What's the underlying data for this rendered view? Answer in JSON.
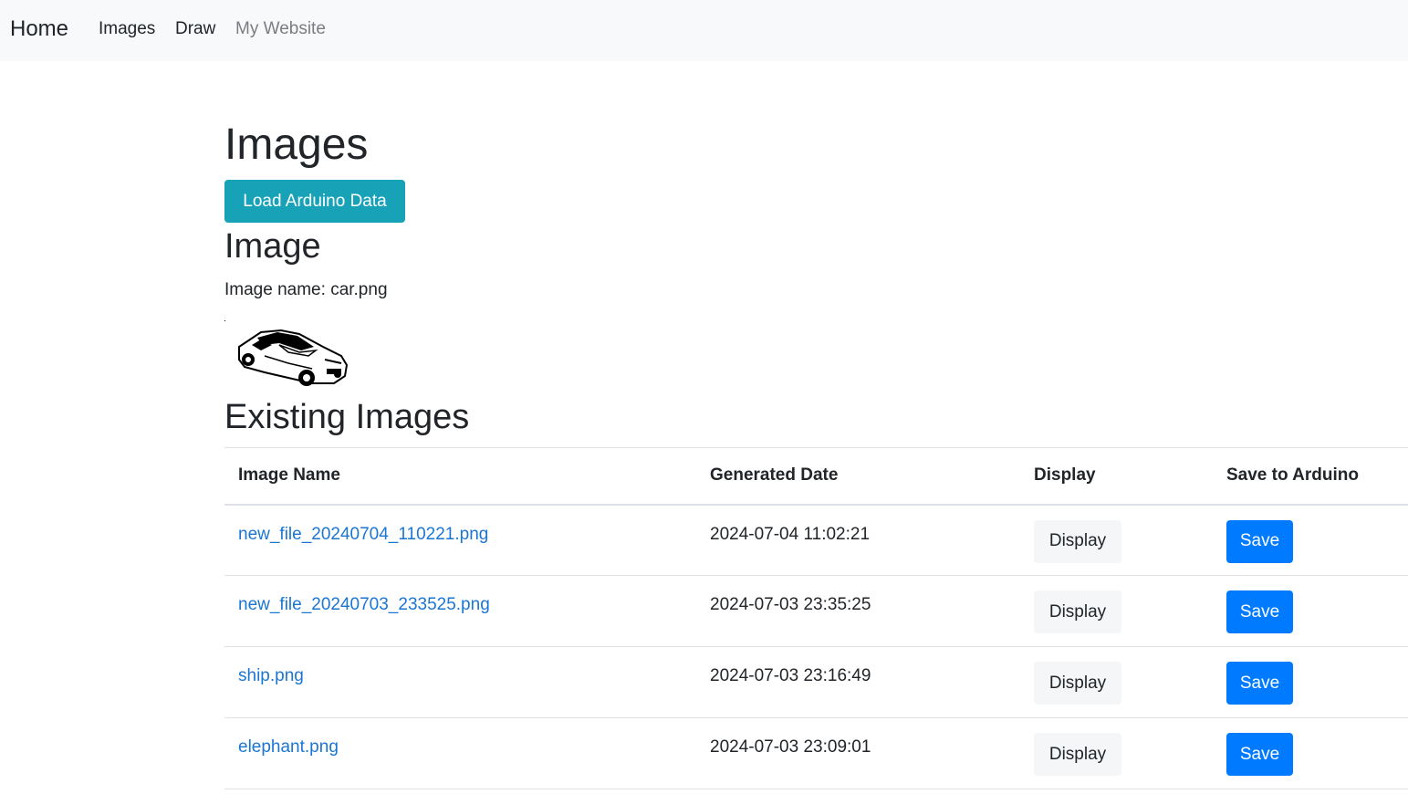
{
  "nav": {
    "brand": "Home",
    "links": [
      {
        "label": "Images"
      },
      {
        "label": "Draw"
      },
      {
        "label": "My Website"
      }
    ]
  },
  "page": {
    "title": "Images",
    "load_button": "Load Arduino Data",
    "image_heading": "Image",
    "image_name_label": "Image name:",
    "image_name_value": "car.png",
    "existing_heading": "Existing Images"
  },
  "table": {
    "headers": [
      "Image Name",
      "Generated Date",
      "Display",
      "Save to Arduino"
    ],
    "rows": [
      {
        "name": "new_file_20240704_110221.png",
        "date": "2024-07-04 11:02:21",
        "display": "Display",
        "save": "Save"
      },
      {
        "name": "new_file_20240703_233525.png",
        "date": "2024-07-03 23:35:25",
        "display": "Display",
        "save": "Save"
      },
      {
        "name": "ship.png",
        "date": "2024-07-03 23:16:49",
        "display": "Display",
        "save": "Save"
      },
      {
        "name": "elephant.png",
        "date": "2024-07-03 23:09:01",
        "display": "Display",
        "save": "Save"
      }
    ]
  },
  "colors": {
    "navbar_bg": "#f8f9fa",
    "info_button": "#17a2b8",
    "primary_button": "#007bff",
    "link": "#1b76d2"
  }
}
